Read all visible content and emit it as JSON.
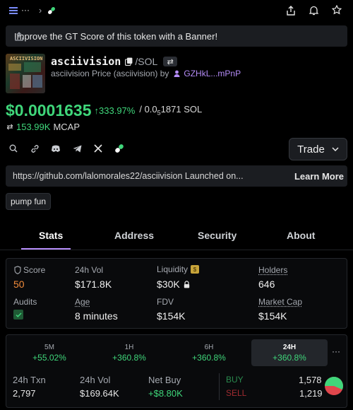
{
  "banner": {
    "text": "Improve the GT Score of this token with a Banner!"
  },
  "token": {
    "image_text": "ASCIIVISION",
    "name": "asciivision",
    "pair": "/SOL",
    "subtitle_prefix": "asciivision Price (asciivision) by",
    "creator": "GZHkL...mPnP",
    "price": "$0.0001635",
    "change": "333.97%",
    "sol_price_prefix": "/ 0.0",
    "sol_price_sub": "5",
    "sol_price_suffix": "1871 SOL",
    "mcap_value": "153.99K",
    "mcap_label": "MCAP"
  },
  "actions": {
    "trade_label": "Trade"
  },
  "link": {
    "text": "https://github.com/lalomorales22/asciivision Launched on...",
    "learn_more": "Learn More"
  },
  "tags": [
    "pump fun"
  ],
  "tabs": [
    "Stats",
    "Address",
    "Security",
    "About"
  ],
  "stats": {
    "score_label": "Score",
    "score_value": "50",
    "vol_label": "24h Vol",
    "vol_value": "$171.8K",
    "liq_label": "Liquidity",
    "liq_value": "$30K",
    "holders_label": "Holders",
    "holders_value": "646",
    "audits_label": "Audits",
    "age_label": "Age",
    "age_value": "8 minutes",
    "fdv_label": "FDV",
    "fdv_value": "$154K",
    "mcap_label": "Market Cap",
    "mcap_value": "$154K"
  },
  "timeframes": [
    {
      "key": "5M",
      "value": "+55.02%"
    },
    {
      "key": "1H",
      "value": "+360.8%"
    },
    {
      "key": "6H",
      "value": "+360.8%"
    },
    {
      "key": "24H",
      "value": "+360.8%"
    }
  ],
  "txn": {
    "txn_label": "24h Txn",
    "txn_value": "2,797",
    "vol_label": "24h Vol",
    "vol_value": "$169.64K",
    "netbuy_label": "Net Buy",
    "netbuy_value": "+$8.80K",
    "buy_label": "BUY",
    "buy_value": "1,578",
    "sell_label": "SELL",
    "sell_value": "1,219",
    "buy_share": 0.564
  },
  "colors": {
    "accent": "#3fd67a",
    "purple": "#b58cf8",
    "red": "#e0464c",
    "score": "#f08a3a"
  }
}
